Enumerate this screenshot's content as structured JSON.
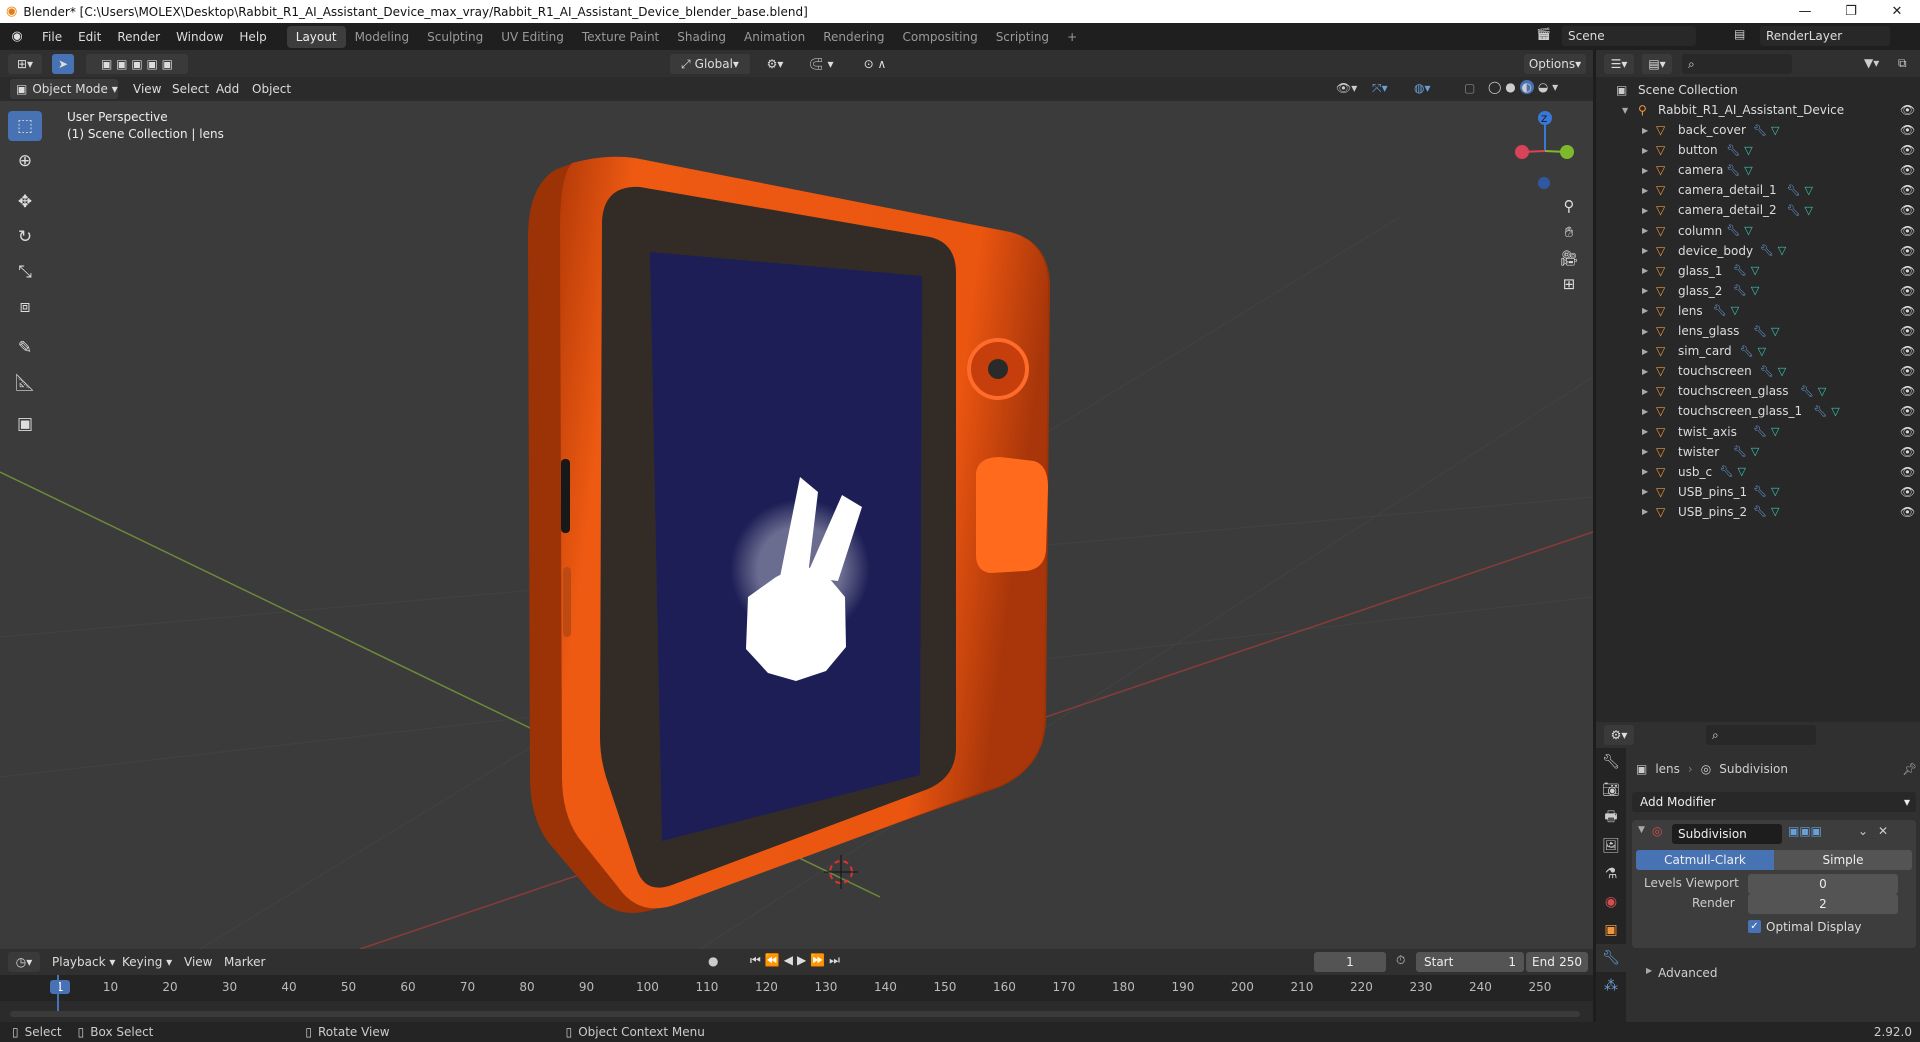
{
  "window": {
    "title": "Blender* [C:\\Users\\MOLEX\\Desktop\\Rabbit_R1_AI_Assistant_Device_max_vray/Rabbit_R1_AI_Assistant_Device_blender_base.blend]",
    "min": "—",
    "max": "❐",
    "close": "✕"
  },
  "menu": [
    "File",
    "Edit",
    "Render",
    "Window",
    "Help"
  ],
  "workspaces": [
    "Layout",
    "Modeling",
    "Sculpting",
    "UV Editing",
    "Texture Paint",
    "Shading",
    "Animation",
    "Rendering",
    "Compositing",
    "Scripting"
  ],
  "scene": "Scene",
  "render_layer": "RenderLayer",
  "vp": {
    "mode": "Object Mode",
    "menus": [
      "View",
      "Select",
      "Add",
      "Object"
    ],
    "orientation": "Global",
    "options": "Options",
    "persp": "User Perspective",
    "collection": "(1) Scene Collection | lens"
  },
  "outliner": {
    "root": "Scene Collection",
    "collection": "Rabbit_R1_AI_Assistant_Device",
    "items": [
      "back_cover",
      "button",
      "camera",
      "camera_detail_1",
      "camera_detail_2",
      "column",
      "device_body",
      "glass_1",
      "glass_2",
      "lens",
      "lens_glass",
      "sim_card",
      "touchscreen",
      "touchscreen_glass",
      "touchscreen_glass_1",
      "twist_axis",
      "twister",
      "usb_c",
      "USB_pins_1",
      "USB_pins_2"
    ]
  },
  "props": {
    "object": "lens",
    "modifier_crumb": "Subdivision",
    "add_modifier": "Add Modifier",
    "mod_name": "Subdivision",
    "tab_catmull": "Catmull-Clark",
    "tab_simple": "Simple",
    "levels_label": "Levels Viewport",
    "levels_val": "0",
    "render_label": "Render",
    "render_val": "2",
    "optimal": "Optimal Display",
    "advanced": "Advanced"
  },
  "timeline": {
    "menus": [
      "Playback",
      "Keying",
      "View",
      "Marker"
    ],
    "current": "1",
    "start_label": "Start",
    "start": "1",
    "end_label": "End",
    "end": "250",
    "ticks": [
      "1",
      "10",
      "20",
      "30",
      "40",
      "50",
      "60",
      "70",
      "80",
      "90",
      "100",
      "110",
      "120",
      "130",
      "140",
      "150",
      "160",
      "170",
      "180",
      "190",
      "200",
      "210",
      "220",
      "230",
      "240",
      "250"
    ]
  },
  "status": {
    "select": "Select",
    "box": "Box Select",
    "rotate": "Rotate View",
    "context": "Object Context Menu",
    "version": "2.92.0"
  },
  "colors": {
    "accent": "#4772b3",
    "orange": "#f0953a",
    "device": "#ee5a12",
    "screen": "#1c1e55"
  }
}
